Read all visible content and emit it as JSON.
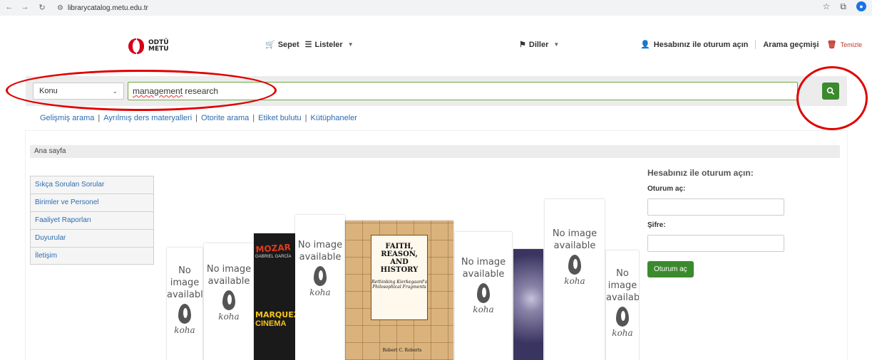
{
  "browser": {
    "url": "librarycatalog.metu.edu.tr",
    "back_icon": "arrow-left-icon",
    "forward_icon": "arrow-right-icon",
    "reload_icon": "reload-icon"
  },
  "header": {
    "logo_line1": "ODTÜ",
    "logo_line2": "METU",
    "cart": "Sepet",
    "lists": "Listeler",
    "languages": "Diller",
    "login": "Hesabınız ile oturum açın",
    "search_history": "Arama geçmişi",
    "clear": "Temizle"
  },
  "search": {
    "field_select": "Konu",
    "query_word1": "management",
    "query_word2": "research"
  },
  "sublinks": [
    "Gelişmiş arama",
    "Ayrılmış ders materyalleri",
    "Otorite arama",
    "Etiket bulutu",
    "Kütüphaneler"
  ],
  "breadcrumb": "Ana sayfa",
  "sidebar": {
    "items": [
      {
        "label": "Sıkça Sorulan Sorular"
      },
      {
        "label": "Birimler ve Personel"
      },
      {
        "label": "Faaliyet Raporları"
      },
      {
        "label": "Duyurular"
      },
      {
        "label": "İletişim"
      }
    ]
  },
  "carousel": {
    "noimage_line1": "No image",
    "noimage_line2": "available",
    "koha": "koha",
    "faith_title": "FAITH, REASON, AND HISTORY",
    "faith_subtitle": "Rethinking Kierkegaard's Philosophical Fragments",
    "faith_author": "Robert C. Roberts"
  },
  "login": {
    "heading": "Hesabınız ile oturum açın:",
    "section": "Oturum aç:",
    "password_label": "Şifre:",
    "submit": "Oturum aç"
  },
  "annotation_color": "#e00000",
  "accent_color": "#3c8a2e"
}
